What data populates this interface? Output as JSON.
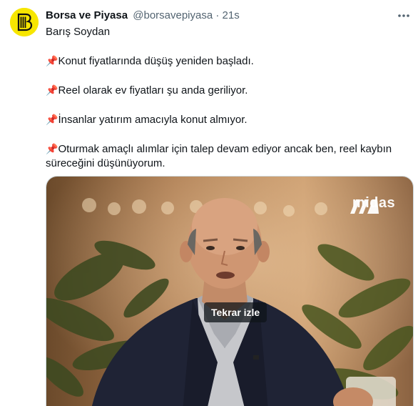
{
  "tweet": {
    "display_name": "Borsa ve Piyasa",
    "handle": "@borsavepiyasa",
    "separator": "·",
    "time": "21s",
    "author_line": "Barış Soydan",
    "pin_emoji": "📌",
    "lines": [
      "Konut fiyatlarında düşüş yeniden başladı.",
      "Reel olarak ev fiyatları şu anda geriliyor.",
      "İnsanlar yatırım amacıyla konut almıyor.",
      "Oturmak amaçlı alımlar için talep devam ediyor ancak ben, reel kaybın süreceğini düşünüyorum."
    ]
  },
  "avatar": {
    "icon": "borsa-ve-piyasa-logo",
    "background": "#f7e600"
  },
  "media": {
    "watermark_text": "midas",
    "replay_label": "Tekrar izle",
    "icons": [
      "midas-logo-icon"
    ]
  },
  "colors": {
    "text": "#0f1419",
    "secondary": "#536471",
    "border": "#cfd9de"
  }
}
